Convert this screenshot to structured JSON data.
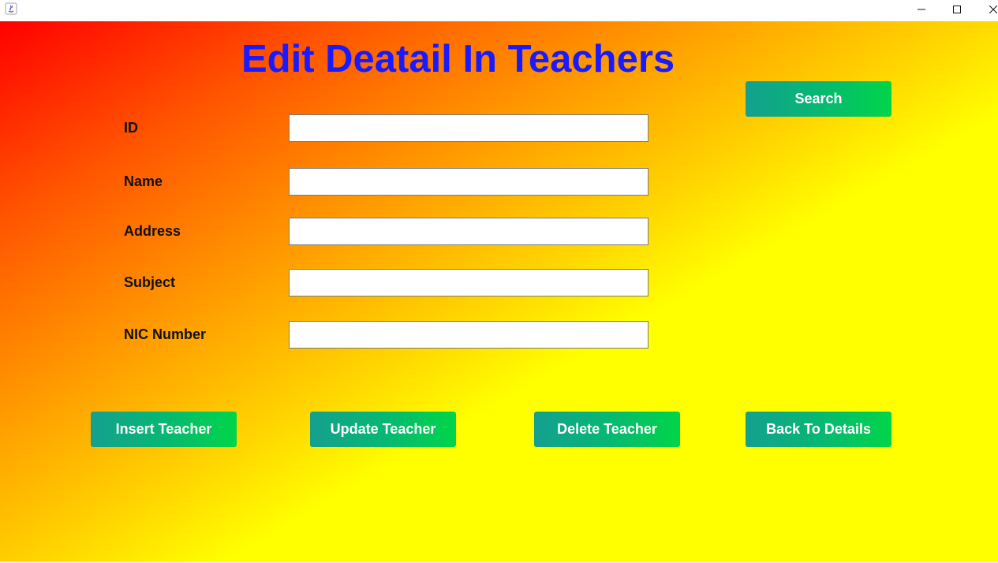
{
  "window": {
    "app_icon": "java-icon",
    "controls": [
      "minimize-icon",
      "maximize-icon",
      "close-icon"
    ]
  },
  "form": {
    "title": "Edit Deatail In Teachers",
    "fields": [
      {
        "label": "ID",
        "value": ""
      },
      {
        "label": "Name",
        "value": ""
      },
      {
        "label": "Address",
        "value": ""
      },
      {
        "label": "Subject",
        "value": ""
      },
      {
        "label": "NIC Number",
        "value": ""
      }
    ]
  },
  "buttons": {
    "search": "Search",
    "insert": "Insert Teacher",
    "update": "Update Teacher",
    "delete": "Delete Teacher",
    "back": "Back To Details"
  },
  "colors": {
    "title": "#1a1aff",
    "button_start": "#14a08f",
    "button_end": "#00d548",
    "background_start": "#ff0000",
    "background_end": "#ffff00"
  }
}
